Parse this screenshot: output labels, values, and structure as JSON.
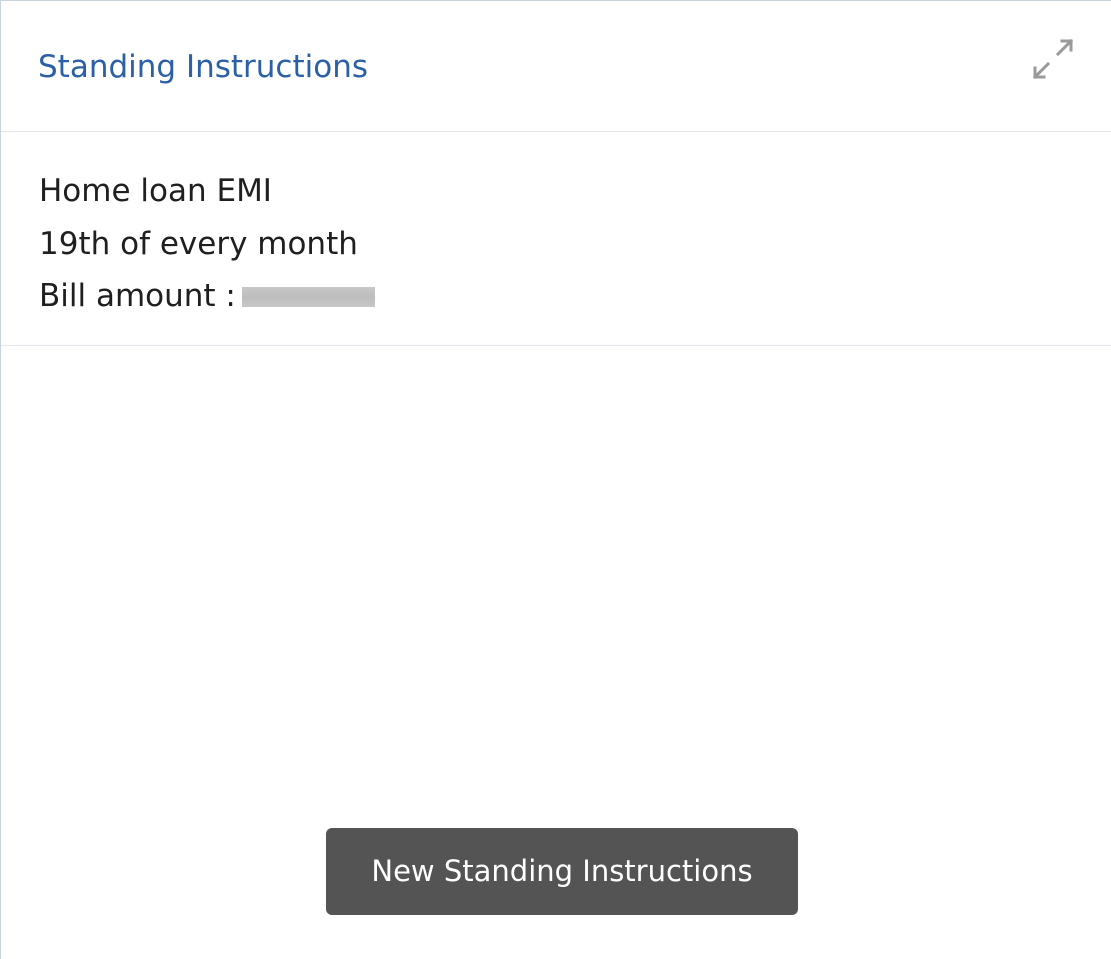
{
  "card": {
    "title": "Standing Instructions",
    "expand_icon": "expand-arrows-icon"
  },
  "instruction": {
    "name": "Home loan EMI",
    "schedule": "19th of every month",
    "amount_label": "Bill amount :",
    "amount_masked": true
  },
  "actions": {
    "new_label": "New Standing Instructions"
  },
  "colors": {
    "title": "#2b5fa6",
    "button_bg": "#545454",
    "button_text": "#ffffff",
    "divider": "#e3e7ec"
  }
}
